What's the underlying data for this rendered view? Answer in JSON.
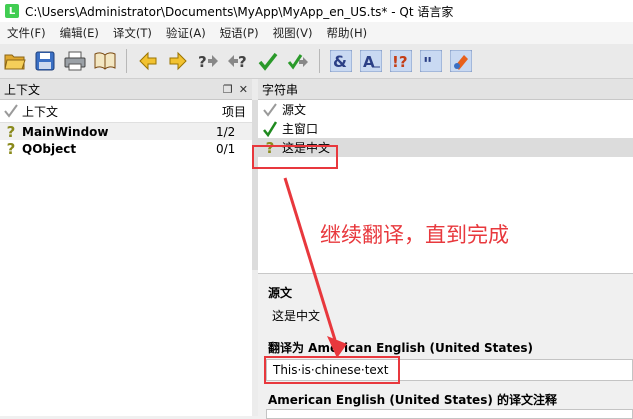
{
  "window": {
    "title": "C:\\Users\\Administrator\\Documents\\MyApp\\MyApp_en_US.ts* - Qt 语言家",
    "app_icon_letter": "L"
  },
  "menu": [
    "文件(F)",
    "编辑(E)",
    "译文(T)",
    "验证(A)",
    "短语(P)",
    "视图(V)",
    "帮助(H)"
  ],
  "toolbar_icons": [
    "open-icon",
    "save-icon",
    "print-icon",
    "phrasebook-icon",
    "prev-icon",
    "next-icon",
    "prev-unfinished-icon",
    "next-unfinished-icon",
    "done-next-icon",
    "done-icon",
    "accelerator-icon",
    "surrounding-whitespace-icon",
    "punctuation-icon",
    "phrase-match-icon",
    "placeholder-icon"
  ],
  "context_panel": {
    "title": "上下文",
    "columns": {
      "context": "上下文",
      "items": "项目"
    },
    "rows": [
      {
        "status": "?",
        "name": "MainWindow",
        "count": "1/2"
      },
      {
        "status": "?",
        "name": "QObject",
        "count": "0/1"
      }
    ]
  },
  "strings_panel": {
    "title": "字符串",
    "column_source": "源文",
    "rows": [
      {
        "status": "✓",
        "text": "主窗口"
      },
      {
        "status": "?",
        "text": "这是中文"
      }
    ]
  },
  "editor": {
    "source_label": "源文",
    "source_text": "这是中文",
    "translation_label": "翻译为 American English (United States)",
    "translation_value": "This·is·chinese·text",
    "comment_label": "American English (United States) 的译文注释"
  },
  "annotation": {
    "text": "继续翻译，直到完成",
    "color": "#e8383d"
  },
  "colors": {
    "accent_red": "#e8383d",
    "check_green": "#1f8a1f",
    "question_olive": "#8a8a1c"
  }
}
